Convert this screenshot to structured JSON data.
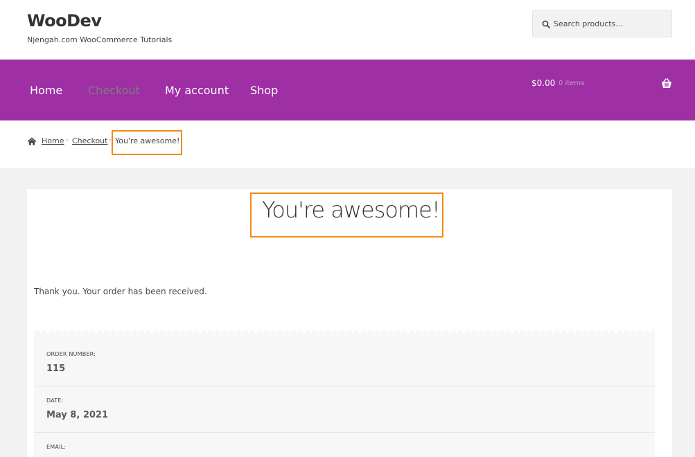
{
  "header": {
    "site_title": "WooDev",
    "tagline": "Njengah.com WooCommerce Tutorials",
    "search_placeholder": "Search products…"
  },
  "nav": {
    "items": [
      {
        "label": "Home"
      },
      {
        "label": "Checkout",
        "current": true
      },
      {
        "label": "My account"
      },
      {
        "label": "Shop"
      }
    ],
    "cart": {
      "amount": "$0.00",
      "count": "0 items"
    }
  },
  "breadcrumb": {
    "home": "Home",
    "checkout": "Checkout",
    "current": "You're awesome!"
  },
  "main": {
    "title": "You're awesome!",
    "thankyou": "Thank you. Your order has been received.",
    "order_details": [
      {
        "label": "ORDER NUMBER:",
        "value": "115"
      },
      {
        "label": "DATE:",
        "value": "May 8, 2021"
      },
      {
        "label": "EMAIL:",
        "value": ""
      }
    ]
  },
  "colors": {
    "nav_bg": "#9e2fa4",
    "highlight_border": "#f28a15",
    "content_bg": "#f2f2f2"
  },
  "icons": [
    "search-icon",
    "cart-icon",
    "home-icon"
  ]
}
